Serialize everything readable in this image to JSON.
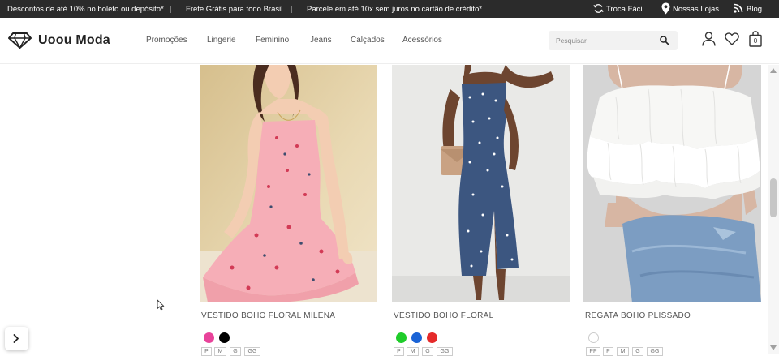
{
  "topbar": {
    "promo1": "Descontos de até 10% no boleto ou depósito*",
    "promo2": "Frete Grátis para todo Brasil",
    "promo3": "Parcele em até 10x sem juros no cartão de crédito*",
    "separator": "|",
    "links": [
      {
        "label": "Troca Fácil",
        "icon": "refresh-icon"
      },
      {
        "label": "Nossas Lojas",
        "icon": "map-pin-icon"
      },
      {
        "label": "Blog",
        "icon": "rss-icon"
      }
    ]
  },
  "header": {
    "brand": "Uoou Moda",
    "nav": [
      "Promoções",
      "Lingerie",
      "Feminino",
      "Jeans",
      "Calçados",
      "Acessórios"
    ],
    "search_placeholder": "Pesquisar",
    "cart_count": "0"
  },
  "products": [
    {
      "name": "VESTIDO BOHO FLORAL MILENA",
      "colors": [
        "#e8439a",
        "#000000"
      ],
      "sizes": [
        "P",
        "M",
        "G",
        "GG"
      ]
    },
    {
      "name": "VESTIDO BOHO FLORAL",
      "colors": [
        "#1fcc2a",
        "#1a63d6",
        "#e52a2a"
      ],
      "sizes": [
        "P",
        "M",
        "G",
        "GG"
      ]
    },
    {
      "name": "REGATA BOHO PLISSADO",
      "colors": [
        "#ffffff"
      ],
      "sizes": [
        "PP",
        "P",
        "M",
        "G",
        "GG"
      ]
    }
  ]
}
